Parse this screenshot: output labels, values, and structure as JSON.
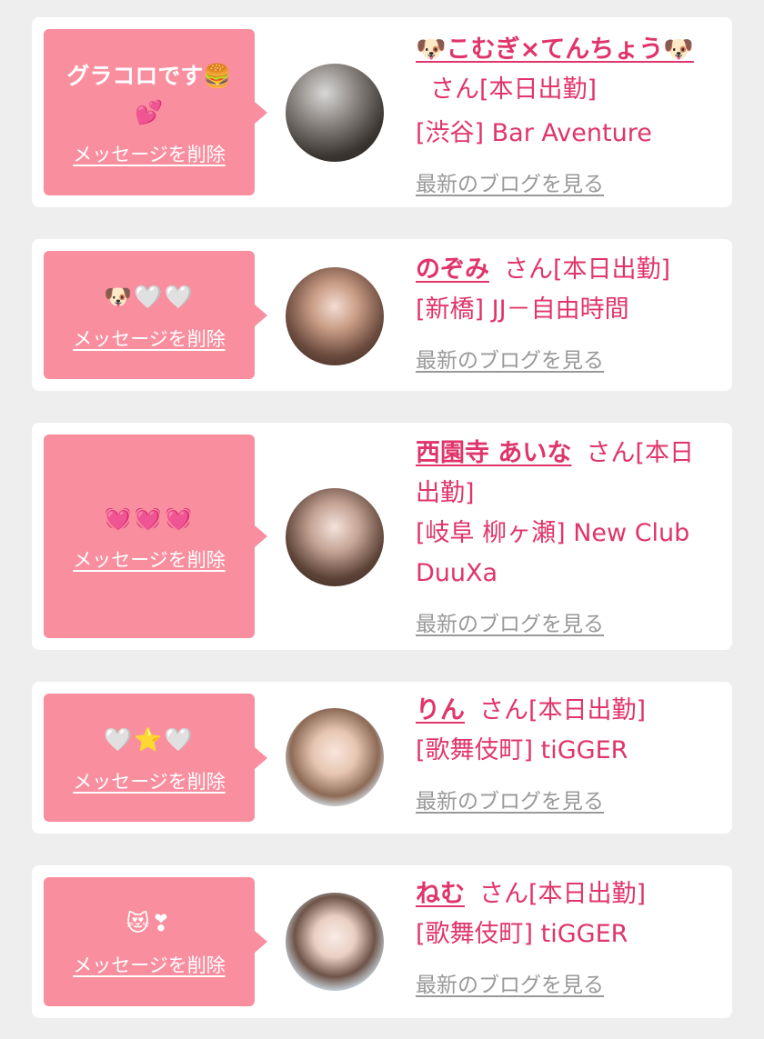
{
  "cards": [
    {
      "message": "グラコロです🍔💕",
      "delete_label": "メッセージを削除",
      "name": "🐶こむぎ×てんちょう🐶",
      "suffix": "さん[本日出勤]",
      "shop": "[渋谷] Bar Aventure",
      "blog_label": "最新のブログを見る"
    },
    {
      "message": "🐶🤍🤍",
      "delete_label": "メッセージを削除",
      "name": "のぞみ",
      "suffix": "さん[本日出勤]",
      "shop": "[新橋] JJ－自由時間",
      "blog_label": "最新のブログを見る"
    },
    {
      "message": "💓💓💓",
      "delete_label": "メッセージを削除",
      "name": "西園寺 あいな",
      "suffix": "さん[本日出勤]",
      "shop": "[岐阜 柳ヶ瀬] New Club DuuXa",
      "blog_label": "最新のブログを見る"
    },
    {
      "message": "🤍⭐🤍",
      "delete_label": "メッセージを削除",
      "name": "りん",
      "suffix": "さん[本日出勤]",
      "shop": "[歌舞伎町] tiGGER",
      "blog_label": "最新のブログを見る"
    },
    {
      "message": "😻❣",
      "delete_label": "メッセージを削除",
      "name": "ねむ",
      "suffix": "さん[本日出勤]",
      "shop": "[歌舞伎町] tiGGER",
      "blog_label": "最新のブログを見る"
    }
  ],
  "colors": {
    "bubble": "#f98e9e",
    "accent": "#e0356a",
    "muted": "#999999",
    "background": "#eeeeee"
  }
}
